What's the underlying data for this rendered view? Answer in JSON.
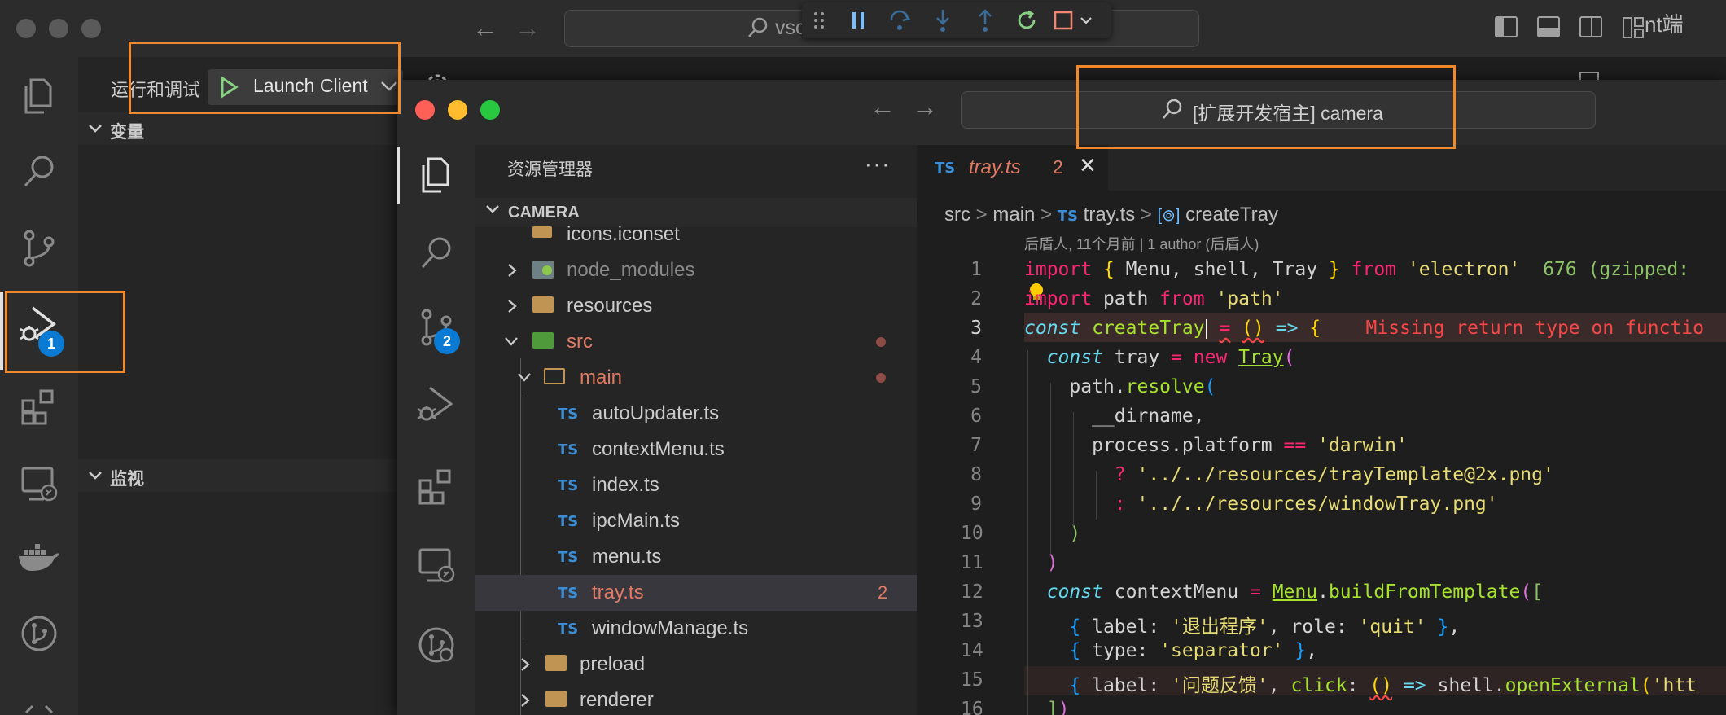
{
  "outer": {
    "search_text": "vsc",
    "right_text": "nt端",
    "panel_title": "运行和调试",
    "launch_config": "Launch Client",
    "sections": [
      {
        "label": "变量"
      },
      {
        "label": "监视"
      }
    ],
    "debug_badge": "1"
  },
  "inner": {
    "search_text": "[扩展开发宿主] camera",
    "scm_badge": "2",
    "explorer_title": "资源管理器",
    "explorer_more": "···",
    "workspace": "CAMERA",
    "tree": [
      {
        "label": "icons.iconset"
      },
      {
        "label": "node_modules"
      },
      {
        "label": "resources"
      },
      {
        "label": "src"
      },
      {
        "label": "main"
      },
      {
        "label": "autoUpdater.ts"
      },
      {
        "label": "contextMenu.ts"
      },
      {
        "label": "index.ts"
      },
      {
        "label": "ipcMain.ts"
      },
      {
        "label": "menu.ts"
      },
      {
        "label": "tray.ts",
        "errors": "2"
      },
      {
        "label": "windowManage.ts"
      },
      {
        "label": "preload"
      },
      {
        "label": "renderer"
      }
    ],
    "ts_badge": "TS"
  },
  "editor": {
    "tab": {
      "name": "tray.ts",
      "errors": "2",
      "close": "✕"
    },
    "breadcrumb": {
      "parts": [
        "src",
        "main",
        "tray.ts",
        "createTray"
      ]
    },
    "blame": "后盾人, 11个月前 | 1 author (后盾人)",
    "line_numbers": [
      "1",
      "2",
      "3",
      "4",
      "5",
      "6",
      "7",
      "8",
      "9",
      "10",
      "11",
      "12",
      "13",
      "14",
      "15",
      "16"
    ],
    "inline_hints": {
      "size": "676 (gzipped:",
      "error": "Missing return type on functio"
    },
    "strings": {
      "electron": "'electron'",
      "path": "'path'",
      "darwin": "'darwin'",
      "tray_template": "'../../resources/trayTemplate@2x.png'",
      "window_tray": "'../../resources/windowTray.png'",
      "quit_label": "'退出程序'",
      "quit": "'quit'",
      "separator": "'separator'",
      "feedback": "'问题反馈'",
      "htt": "'htt"
    }
  },
  "colors": {
    "highlight_box": "#f0892b",
    "error": "#e27a63",
    "badge": "#0a7bd4"
  }
}
